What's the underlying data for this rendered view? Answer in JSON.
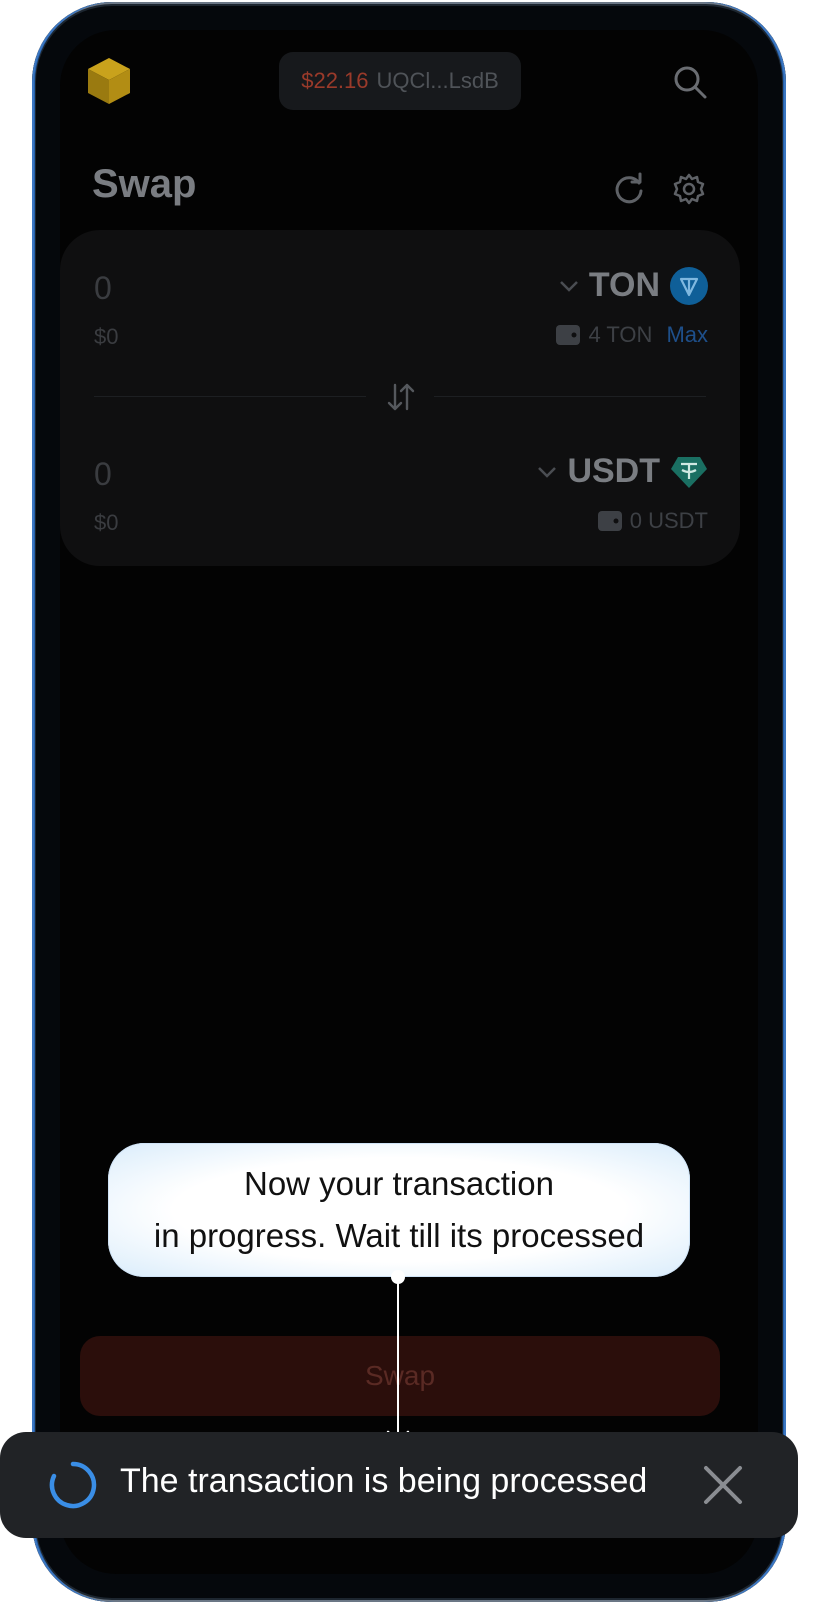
{
  "header": {
    "wallet_amount": "$22.16",
    "wallet_address": "UQCl...LsdB"
  },
  "swap": {
    "title": "Swap",
    "from": {
      "amount": "0",
      "usd": "$0",
      "token": "TON",
      "balance": "4 TON",
      "max_label": "Max"
    },
    "to": {
      "amount": "0",
      "usd": "$0",
      "token": "USDT",
      "balance": "0 USDT"
    },
    "button_label": "Swap"
  },
  "tooltip": {
    "line1": "Now your transaction",
    "line2": "in progress. Wait till its processed"
  },
  "toast": {
    "message": "The transaction is being processed"
  },
  "colors": {
    "accent_red": "#9a3a2a",
    "ton_blue": "#0f72b6",
    "usdt_teal": "#1f8a77",
    "spinner_blue": "#3a8ee6"
  },
  "icons": [
    "cube-logo-icon",
    "search-icon",
    "refresh-icon",
    "gear-icon",
    "chevron-down-icon",
    "ton-token-icon",
    "usdt-token-icon",
    "wallet-icon",
    "swap-arrows-icon",
    "spinner-icon",
    "close-icon"
  ]
}
